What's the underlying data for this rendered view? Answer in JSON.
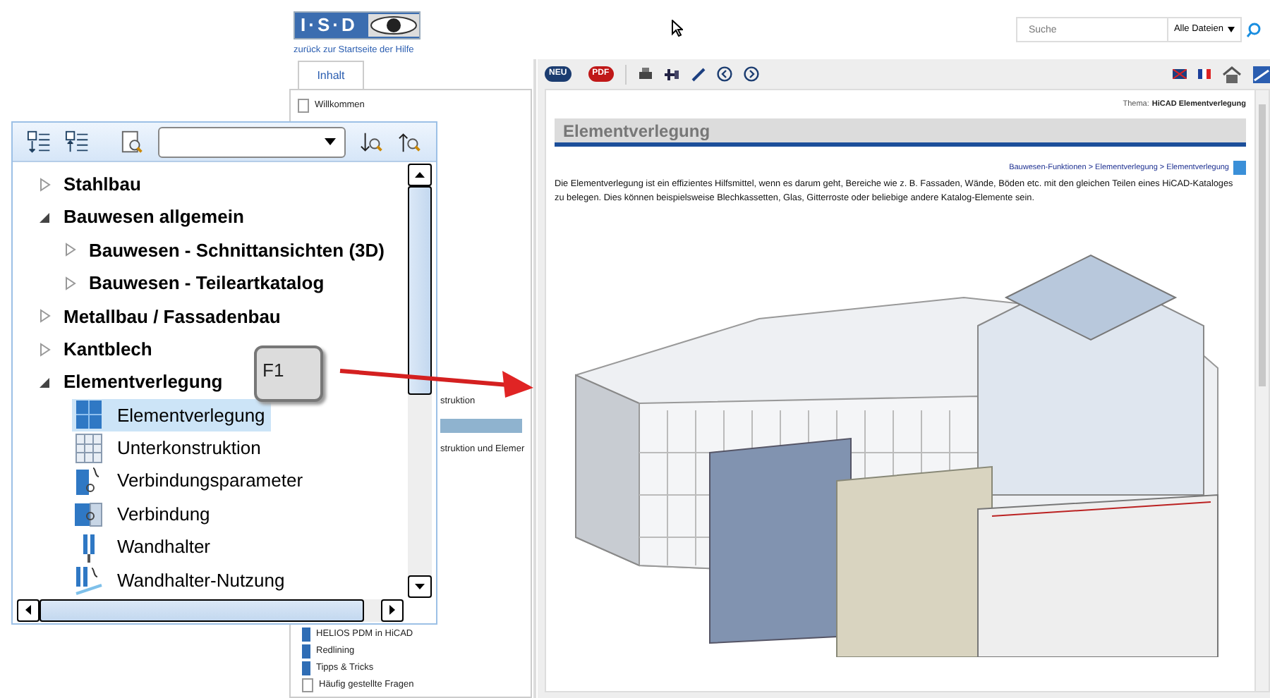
{
  "help_page": {
    "logo_text": "I·S·D",
    "back_link": "zurück zur Startseite der Hilfe",
    "search": {
      "placeholder": "Suche",
      "scope": "Alle Dateien"
    },
    "tabs": [
      {
        "label": "Inhalt",
        "selected": true
      }
    ],
    "toc_top": [
      {
        "label": "Willkommen",
        "kind": "page"
      }
    ],
    "toc_middle": [
      {
        "label": "struktion",
        "selected": false
      },
      {
        "selected": true
      },
      {
        "label": "struktion und Elemer",
        "selected": false
      }
    ],
    "toc_bottom": [
      {
        "label": "HELIOS PDM in HiCAD",
        "kind": "book"
      },
      {
        "label": "Redlining",
        "kind": "book"
      },
      {
        "label": "Tipps & Tricks",
        "kind": "book"
      },
      {
        "label": "Häufig gestellte Fragen",
        "kind": "page"
      }
    ],
    "toolbar": {
      "new_label": "NEU",
      "pdf_label": "PDF"
    },
    "topic_label": "Thema:",
    "topic": "HiCAD Elementverlegung",
    "heading": "Elementverlegung",
    "breadcrumb": "Bauwesen-Funktionen > Elementverlegung > Elementverlegung",
    "paragraph": "Die Elementverlegung ist ein effizientes Hilfsmittel, wenn es darum geht, Bereiche wie z. B. Fassaden, Wände, Böden etc. mit den gleichen Teilen eines HiCAD-Kataloges zu belegen. Dies können beispielsweise Blechkassetten, Glas, Gitterroste oder beliebige andere Katalog-Elemente sein."
  },
  "tree_panel": {
    "items": [
      {
        "label": "Stahlbau",
        "kind": "folder",
        "expanded": false
      },
      {
        "label": "Bauwesen allgemein",
        "kind": "folder",
        "expanded": true,
        "children": [
          {
            "label": "Bauwesen - Schnittansichten (3D)",
            "kind": "folder",
            "expanded": false
          },
          {
            "label": "Bauwesen - Teileartkatalog",
            "kind": "folder",
            "expanded": false
          }
        ]
      },
      {
        "label": "Metallbau / Fassadenbau",
        "kind": "folder",
        "expanded": false
      },
      {
        "label": "Kantblech",
        "kind": "folder",
        "expanded": false
      },
      {
        "label": "Elementverlegung",
        "kind": "folder",
        "expanded": true,
        "children": [
          {
            "label": "Elementverlegung",
            "kind": "function",
            "selected": true
          },
          {
            "label": "Unterkonstruktion",
            "kind": "function",
            "selected": false
          },
          {
            "label": "Verbindungsparameter",
            "kind": "function",
            "selected": false
          },
          {
            "label": "Verbindung",
            "kind": "function",
            "selected": false
          },
          {
            "label": "Wandhalter",
            "kind": "function",
            "selected": false
          },
          {
            "label": "Wandhalter-Nutzung",
            "kind": "function",
            "selected": false
          }
        ]
      }
    ]
  },
  "callout": {
    "key": "F1"
  }
}
